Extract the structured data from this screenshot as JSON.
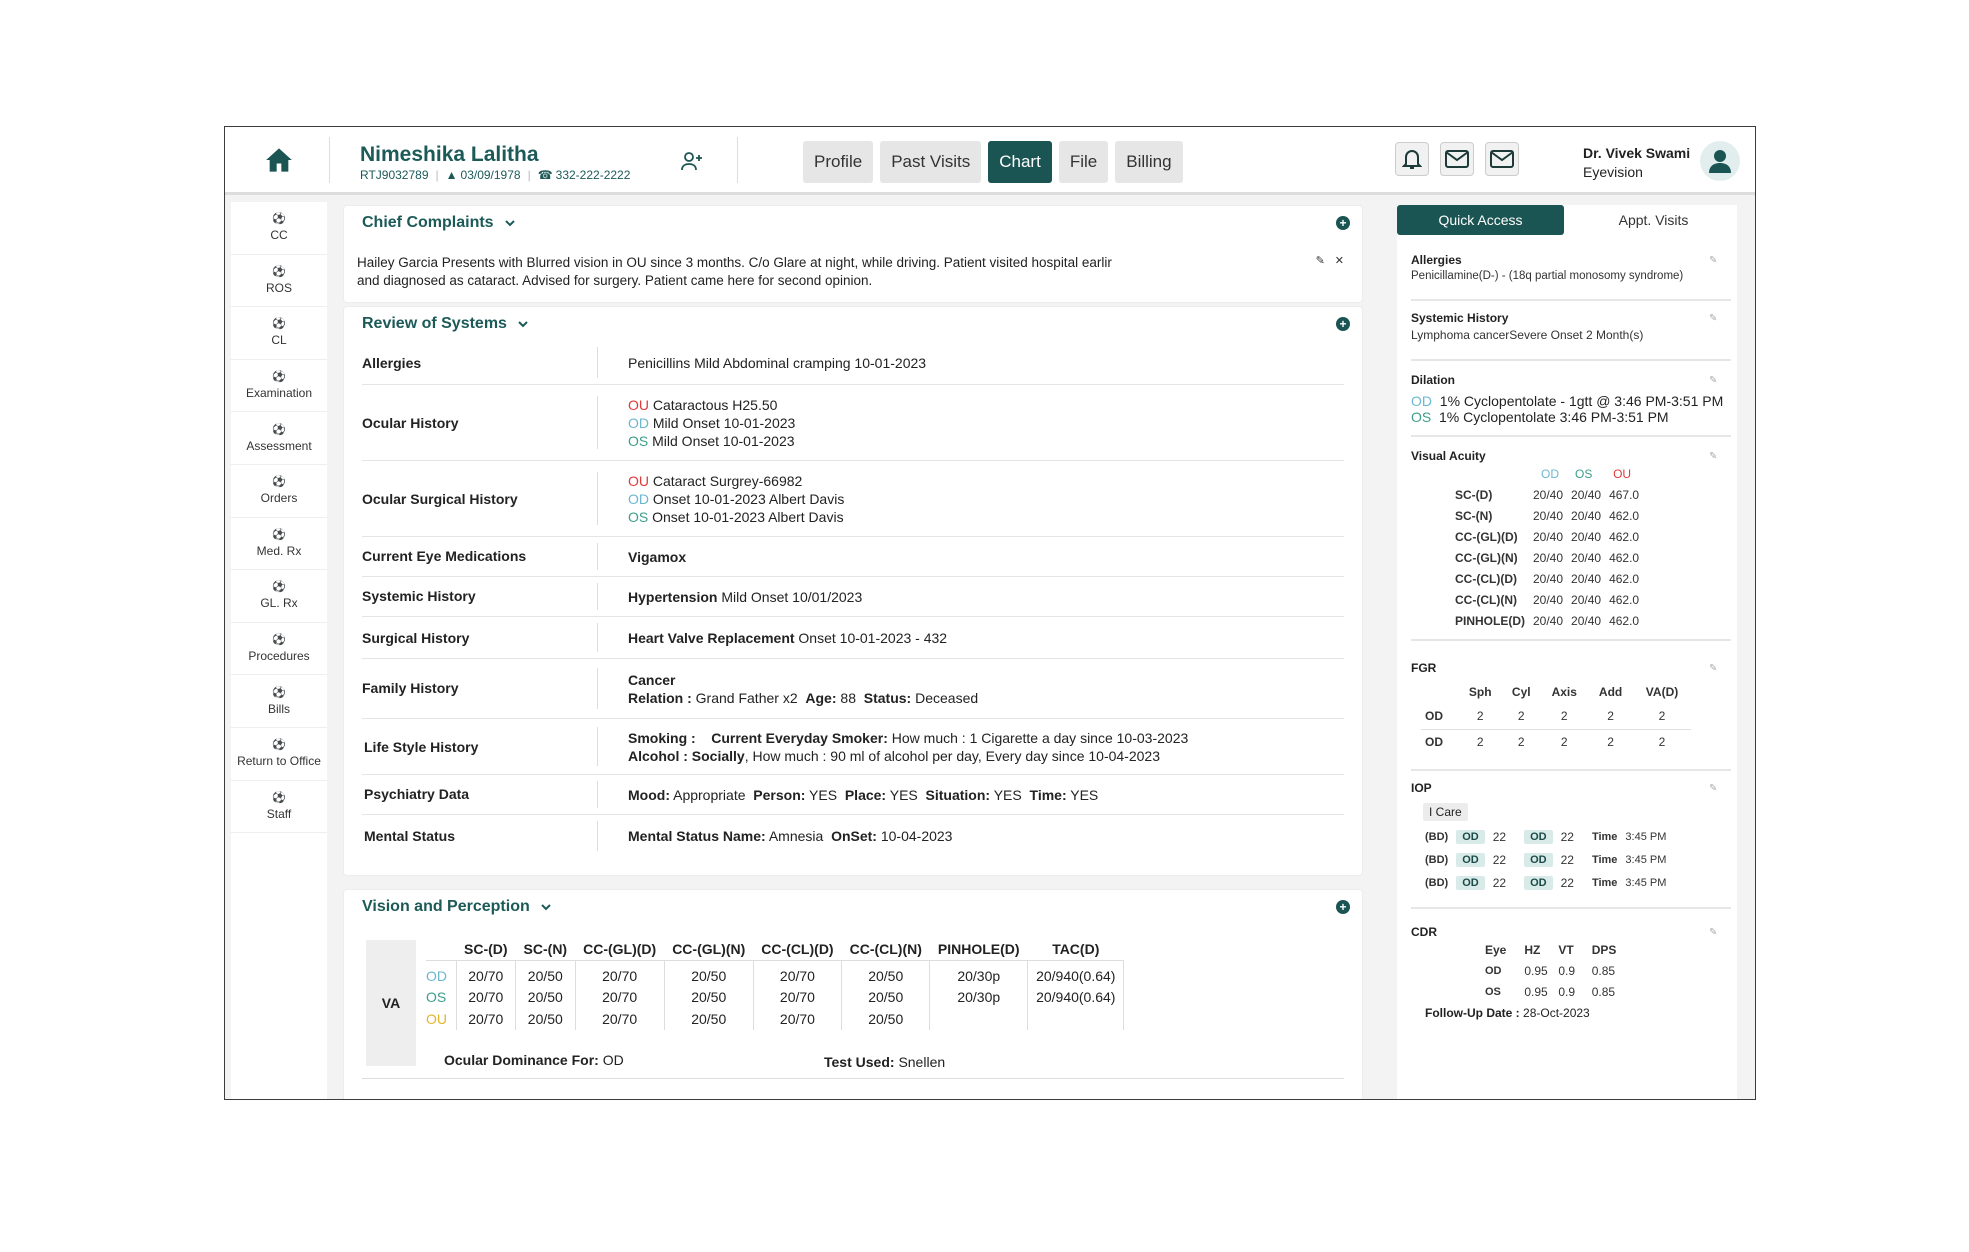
{
  "header": {
    "patient_name": "Nimeshika Lalitha",
    "patient_id": "RTJ9032789",
    "dob": "03/09/1978",
    "phone": "332-222-2222",
    "tabs": [
      {
        "label": "Profile",
        "active": false
      },
      {
        "label": "Past Visits",
        "active": false
      },
      {
        "label": "Chart",
        "active": true
      },
      {
        "label": "File",
        "active": false
      },
      {
        "label": "Billing",
        "active": false
      }
    ],
    "doctor_name": "Dr. Vivek Swami",
    "org": "Eyevision"
  },
  "sidebar": {
    "items": [
      "CC",
      "ROS",
      "CL",
      "Examination",
      "Assessment",
      "Orders",
      "Med. Rx",
      "GL. Rx",
      "Procedures",
      "Bills",
      "Return to Office",
      "Staff"
    ]
  },
  "chief_complaints": {
    "title": "Chief Complaints",
    "text": "Hailey Garcia Presents with Blurred vision in OU since 3 months. C/o Glare at night, while driving. Patient visited hospital earlir and diagnosed as cataract. Advised for surgery. Patient came here for second opinion."
  },
  "ros": {
    "title": "Review of Systems",
    "allergies_label": "Allergies",
    "allergies_value": "Penicillins Mild Abdominal cramping 10-01-2023",
    "ocular_history_label": "Ocular History",
    "ocular_history": [
      {
        "eye": "OU",
        "text": "Cataractous H25.50"
      },
      {
        "eye": "OD",
        "text": "Mild Onset 10-01-2023"
      },
      {
        "eye": "OS",
        "text": "Mild Onset 10-01-2023"
      }
    ],
    "ocular_surgical_label": "Ocular Surgical History",
    "ocular_surgical": [
      {
        "eye": "OU",
        "text": "Cataract Surgrey-66982"
      },
      {
        "eye": "OD",
        "text": "Onset 10-01-2023 Albert Davis"
      },
      {
        "eye": "OS",
        "text": "Onset 10-01-2023 Albert Davis"
      }
    ],
    "eye_meds_label": "Current Eye Medications",
    "eye_meds_value": "Vigamox",
    "systemic_label": "Systemic History",
    "systemic_bold": "Hypertension",
    "systemic_rest": "Mild Onset 10/01/2023",
    "surgical_label": "Surgical History",
    "surgical_bold": "Heart Valve Replacement",
    "surgical_rest": "Onset 10-01-2023 - 432",
    "family_label": "Family History",
    "family_condition": "Cancer",
    "family_relation_label": "Relation :",
    "family_relation": "Grand Father x2",
    "family_age_label": "Age:",
    "family_age": "88",
    "family_status_label": "Status:",
    "family_status": "Deceased",
    "lifestyle_label": "Life Style History",
    "smoking_label": "Smoking :",
    "smoking_status": "Current Everyday Smoker:",
    "smoking_detail": "How much : 1 Cigarette a day since 10-03-2023",
    "alcohol_label": "Alcohol :",
    "alcohol_status": "Socially",
    "alcohol_detail": ", How much : 90 ml of alcohol per day, Every day since 10-04-2023",
    "psych_label": "Psychiatry Data",
    "psych_mood_label": "Mood:",
    "psych_mood": "Appropriate",
    "psych_person_label": "Person:",
    "psych_person": "YES",
    "psych_place_label": "Place:",
    "psych_place": "YES",
    "psych_situation_label": "Situation:",
    "psych_situation": "YES",
    "psych_time_label": "Time:",
    "psych_time": "YES",
    "mental_label": "Mental Status",
    "mental_name_label": "Mental Status Name:",
    "mental_name": "Amnesia",
    "mental_onset_label": "OnSet:",
    "mental_onset": "10-04-2023"
  },
  "vision": {
    "title": "Vision and Perception",
    "va_label": "VA",
    "columns": [
      "SC-(D)",
      "SC-(N)",
      "CC-(GL)(D)",
      "CC-(GL)(N)",
      "CC-(CL)(D)",
      "CC-(CL)(N)",
      "PINHOLE(D)",
      "TAC(D)"
    ],
    "rows": [
      {
        "eye": "OD",
        "values": [
          "20/70",
          "20/50",
          "20/70",
          "20/50",
          "20/70",
          "20/50",
          "20/30p",
          "20/940(0.64)"
        ]
      },
      {
        "eye": "OS",
        "values": [
          "20/70",
          "20/50",
          "20/70",
          "20/50",
          "20/70",
          "20/50",
          "20/30p",
          "20/940(0.64)"
        ]
      },
      {
        "eye": "OU",
        "values": [
          "20/70",
          "20/50",
          "20/70",
          "20/50",
          "20/70",
          "20/50",
          "",
          ""
        ]
      }
    ],
    "dominance_label": "Ocular Dominance For:",
    "dominance": "OD",
    "test_label": "Test Used:",
    "test": "Snellen"
  },
  "quick": {
    "tabs": [
      "Quick Access",
      "Appt. Visits"
    ],
    "allergies_title": "Allergies",
    "allergies_text": "Penicillamine(D-) - (18q partial monosomy syndrome)",
    "systemic_title": "Systemic History",
    "systemic_text": "Lymphoma cancerSevere Onset 2 Month(s)",
    "dilation_title": "Dilation",
    "dilation": [
      {
        "eye": "OD",
        "text": "1% Cyclopentolate - 1gtt @ 3:46 PM-3:51 PM"
      },
      {
        "eye": "OS",
        "text": "1% Cyclopentolate 3:46 PM-3:51 PM"
      }
    ],
    "va_title": "Visual Acuity",
    "va_cols": [
      "OD",
      "OS",
      "OU"
    ],
    "va_rows": [
      {
        "label": "SC-(D)",
        "od": "20/40",
        "os": "20/40",
        "ou": "467.0"
      },
      {
        "label": "SC-(N)",
        "od": "20/40",
        "os": "20/40",
        "ou": "462.0"
      },
      {
        "label": "CC-(GL)(D)",
        "od": "20/40",
        "os": "20/40",
        "ou": "462.0"
      },
      {
        "label": "CC-(GL)(N)",
        "od": "20/40",
        "os": "20/40",
        "ou": "462.0"
      },
      {
        "label": "CC-(CL)(D)",
        "od": "20/40",
        "os": "20/40",
        "ou": "462.0"
      },
      {
        "label": "CC-(CL)(N)",
        "od": "20/40",
        "os": "20/40",
        "ou": "462.0"
      },
      {
        "label": "PINHOLE(D)",
        "od": "20/40",
        "os": "20/40",
        "ou": "462.0"
      }
    ],
    "fgr_title": "FGR",
    "fgr_cols": [
      "Sph",
      "Cyl",
      "Axis",
      "Add",
      "VA(D)"
    ],
    "fgr_rows": [
      {
        "eye": "OD",
        "values": [
          "2",
          "2",
          "2",
          "2",
          "2"
        ]
      },
      {
        "eye": "OD",
        "values": [
          "2",
          "2",
          "2",
          "2",
          "2"
        ]
      }
    ],
    "iop_title": "IOP",
    "iop_device": "I Care",
    "iop_rows": [
      {
        "bd": "(BD)",
        "e1": "OD",
        "v1": "22",
        "e2": "OD",
        "v2": "22",
        "time_label": "Time",
        "time": "3:45 PM"
      },
      {
        "bd": "(BD)",
        "e1": "OD",
        "v1": "22",
        "e2": "OD",
        "v2": "22",
        "time_label": "Time",
        "time": "3:45 PM"
      },
      {
        "bd": "(BD)",
        "e1": "OD",
        "v1": "22",
        "e2": "OD",
        "v2": "22",
        "time_label": "Time",
        "time": "3:45 PM"
      }
    ],
    "cdr_title": "CDR",
    "cdr_cols": [
      "Eye",
      "HZ",
      "VT",
      "DPS"
    ],
    "cdr_rows": [
      {
        "eye": "OD",
        "hz": "0.95",
        "vt": "0.9",
        "dps": "0.85"
      },
      {
        "eye": "OS",
        "hz": "0.95",
        "vt": "0.9",
        "dps": "0.85"
      }
    ],
    "followup_label": "Follow-Up Date :",
    "followup": "28-Oct-2023"
  },
  "colors": {
    "accent": "#1b5553",
    "od": "#6bb7d0",
    "os": "#3c9e8a",
    "ou": "#e03a3a"
  }
}
